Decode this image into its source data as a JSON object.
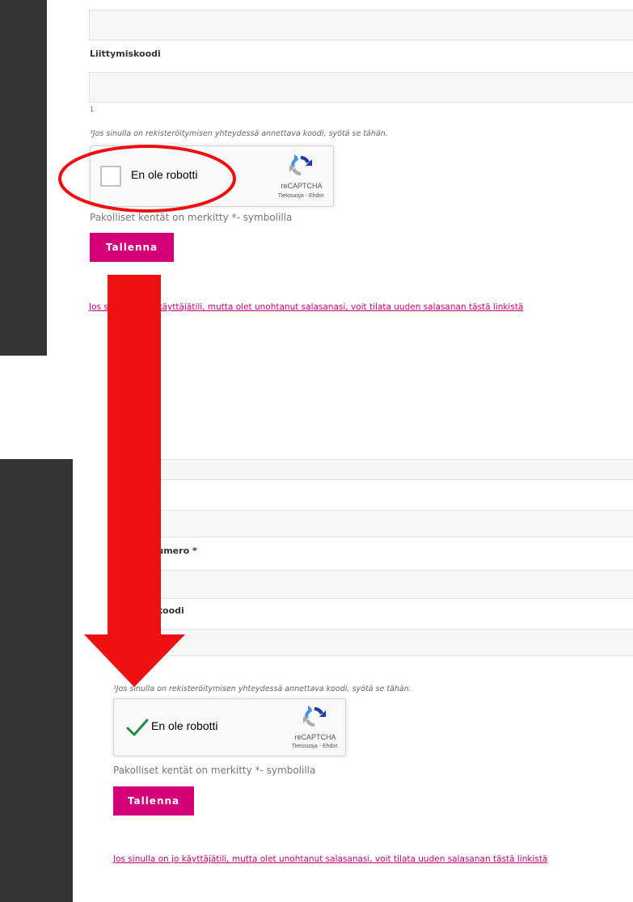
{
  "form": {
    "join_code_label": "Liittymiskoodi",
    "phone_label": "Puhelinnumero *",
    "footnote_marker": "1",
    "hint": "¹Jos sinulla on rekisteröitymisen yhteydessä annettava koodi, syötä se tähän.",
    "required_note": "Pakolliset kentät on merkitty *- symbolilla",
    "save_label": "Tallenna",
    "forgot_link": "Jos sinulla on jo käyttäjätili, mutta olet unohtanut salasanasi, voit tilata uuden salasanan tästä linkistä"
  },
  "recaptcha": {
    "label": "En ole robotti",
    "brand": "reCAPTCHA",
    "terms": "Tietosuoja - Ehdot",
    "icon": "recaptcha-logo-icon"
  },
  "states": {
    "before": {
      "checked": false
    },
    "after": {
      "checked": true,
      "check_icon": "checkmark-icon"
    }
  },
  "colors": {
    "accent": "#d4007a",
    "link": "#cc0077",
    "sidebar": "#343434",
    "annotation": "#ee1111",
    "check": "#1e8e3e"
  },
  "annotations": {
    "highlight": "ellipse around the captcha checkbox",
    "arrow": "from the unchecked state down to the checked state"
  }
}
